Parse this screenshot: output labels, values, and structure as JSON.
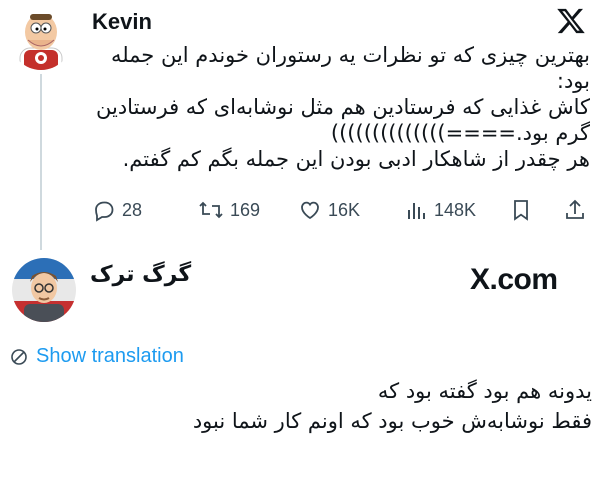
{
  "tweet": {
    "author": "Kevin",
    "lines": [
      "بهترین چیزی که تو نظرات یه رستوران خوندم این جمله",
      "بود:",
      "کاش غذایی که فرستادین هم مثل نوشابه‌ای که فرستادین",
      "گرم بود.====))))))))))))))",
      "هر چقدر از شاهکار ادبی بودن این جمله بگم کم گفتم."
    ],
    "stats": {
      "replies": "28",
      "reposts": "169",
      "likes": "16K",
      "views": "148K"
    }
  },
  "reply": {
    "author": "گرگ ترک",
    "watermark": "X.com",
    "show_translation": "Show translation",
    "lines": [
      "یدونه هم بود گفته بود که",
      "فقط نوشابه‌ش خوب بود که اونم کار شما نبود"
    ]
  },
  "colors": {
    "link": "#1d9bf0",
    "icon": "#3a4a56",
    "thread_line": "#cfd9de"
  },
  "icons": {
    "reply": "reply-icon",
    "repost": "repost-icon",
    "like": "heart-icon",
    "views": "views-icon",
    "bookmark": "bookmark-icon",
    "share": "share-icon",
    "x_logo": "x-logo-icon",
    "translate": "globe-icon"
  }
}
